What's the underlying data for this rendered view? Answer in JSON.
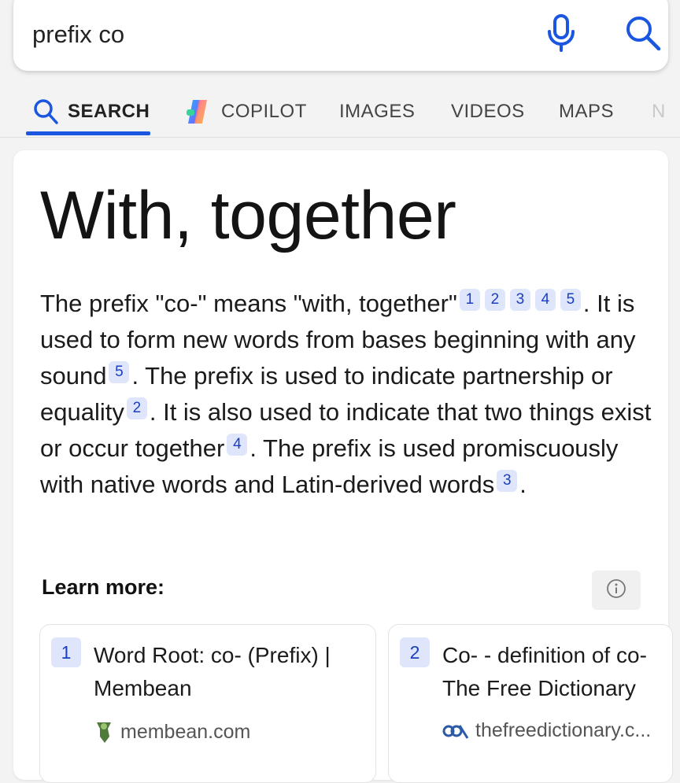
{
  "search": {
    "query": "prefix co"
  },
  "tabs": [
    {
      "label": "SEARCH",
      "active": true
    },
    {
      "label": "COPILOT"
    },
    {
      "label": "IMAGES"
    },
    {
      "label": "VIDEOS"
    },
    {
      "label": "MAPS"
    },
    {
      "label": "N"
    }
  ],
  "answer": {
    "title": "With, together",
    "segments": [
      "The prefix \"co-\" means \"with, together\"",
      ". It is used to form new words from bases beginning with any sound",
      ". The prefix is used to indicate partnership or equality",
      ". It is also used to indicate that two things exist or occur together",
      ". The prefix is used promiscuously with native words and Latin-derived words",
      "."
    ],
    "citations": {
      "c1": [
        "1",
        "2",
        "3",
        "4",
        "5"
      ],
      "c2": [
        "5"
      ],
      "c3": [
        "2"
      ],
      "c4": [
        "4"
      ],
      "c5": [
        "3"
      ]
    }
  },
  "learn_more": {
    "label": "Learn more:",
    "sources": [
      {
        "num": "1",
        "title": "Word Root: co- (Prefix) | Membean",
        "site": "membean.com"
      },
      {
        "num": "2",
        "title": "Co- - definition of co- The Free Dictionary",
        "site": "thefreedictionary.c..."
      }
    ]
  },
  "colors": {
    "accent": "#1a56e0",
    "citation_bg": "#dfe6fb",
    "citation_text": "#1a3fbf"
  },
  "icons": [
    "microphone-icon",
    "search-icon",
    "copilot-icon",
    "info-icon",
    "membean-favicon",
    "freedictionary-favicon"
  ]
}
